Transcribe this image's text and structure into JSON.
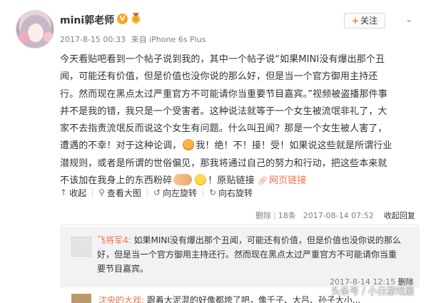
{
  "post": {
    "username": "mini郭老师",
    "verified_badge": "V",
    "time": "2017-8-15 00:33",
    "source": "来自 iPhone 6s Plus",
    "follow_label": "关注",
    "follow_icon": "+",
    "more_icon": "chevron-down-icon",
    "text_lines": [
      "今天看贴吧看到一个帖子说到我的，其中一个帖子说“如果MINI没有爆出那个丑",
      "闻，可能还有价值，但是价值也没你说的那么好，但是当一个官方御用主持还",
      "行。然而现在黑点太过严重官方不可能请你当重要节目嘉宾。”视频被盗播那件事",
      "并不是我的错，我只是一个受害者。这种说法就等于一个女生被流氓非礼了，大",
      "家不去指责流氓反而说这个女生有问题。什么叫丑闻？那是一个女生被人害了，"
    ],
    "line6_before": "遭遇的不幸！对于这种论调，",
    "line6_after": "我！绝！不！接！受！如果说这些就是所谓行业",
    "line7": "潜规则，或者是所谓的世俗偏见，那我将通过自己的努力和行动，把这些本来就",
    "line8_before": "不该加在我身上的东西粉碎",
    "line8_after": "！原贴链接",
    "link_label": "网页链接"
  },
  "toolbar": {
    "collapse": "收起",
    "view_large": "查看大图",
    "rotate_left": "向左旋转",
    "rotate_right": "向右旋转"
  },
  "comment_bar": {
    "delete": "删除",
    "sep": "|",
    "count": "18条",
    "time": "2017-08-14 07:52",
    "reply": "收起回复"
  },
  "comment": {
    "name": "飞将军4:",
    "line1": "如果MINI没有爆出那个丑闻，可能还有价值，但是价值也没你说的那么",
    "line2": "好，但是当一个官方御用主持还行。然而现在黑点太过严重官方不可能请你当重",
    "line3": "要节目嘉宾。",
    "time": "2017-8-14 12:15",
    "delete": "删除"
  },
  "comment2": {
    "name": "沈央的大戏:",
    "text": "跟着大泥混的好像都垮了吧，像千子、大吕、孙子大小..."
  },
  "watermark": "头条号 / 小白游戏屋"
}
